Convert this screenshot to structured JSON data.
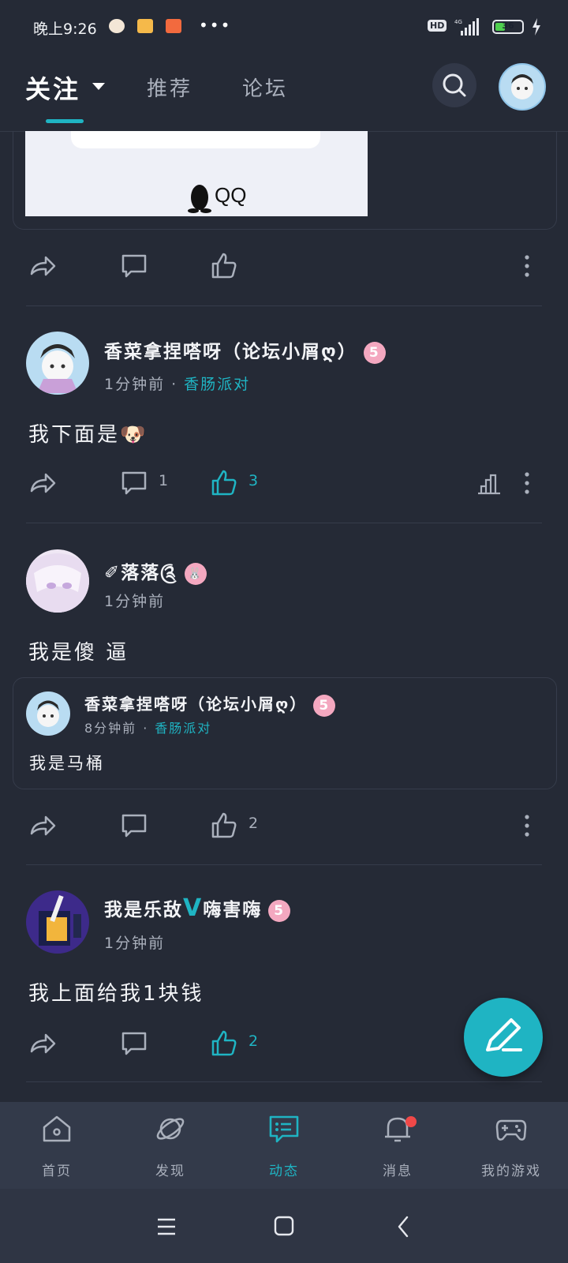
{
  "status_bar": {
    "time": "晚上9:26",
    "dots": "•••",
    "hd": "HD",
    "network": "4G",
    "battery": 36
  },
  "header": {
    "tabs": [
      {
        "label": "关注"
      },
      {
        "label": "推荐"
      },
      {
        "label": "论坛"
      }
    ]
  },
  "prev_post": {
    "image_caption": "QQ"
  },
  "posts": [
    {
      "user": "香菜拿捏嗒呀（论坛小屑ღ）",
      "level": "5",
      "time": "1分钟前",
      "circle": "香肠派对",
      "content": "我下面是🐶",
      "comments": "1",
      "likes": "3"
    },
    {
      "user": "✐落落༊",
      "level": "🐰",
      "time": "1分钟前",
      "content": "我是傻 逼",
      "quote": {
        "user": "香菜拿捏嗒呀（论坛小屑ღ）",
        "level": "5",
        "time": "8分钟前",
        "circle": "香肠派对",
        "content": "我是马桶"
      },
      "likes": "2"
    },
    {
      "user_a": "我是乐敌",
      "user_v": "V",
      "user_b": "嗨害嗨",
      "level": "5",
      "time": "1分钟前",
      "content": "我上面给我1块钱",
      "likes": "2"
    }
  ],
  "bottom_nav": [
    {
      "label": "首页",
      "icon": "home-icon"
    },
    {
      "label": "发现",
      "icon": "planet-icon"
    },
    {
      "label": "动态",
      "icon": "feed-icon"
    },
    {
      "label": "消息",
      "icon": "bell-icon"
    },
    {
      "label": "我的游戏",
      "icon": "gamepad-icon"
    }
  ],
  "colors": {
    "background": "#252a36",
    "accent": "#1fb4c3",
    "level_badge": "#f4a8c0",
    "notification_dot": "#f04848"
  }
}
